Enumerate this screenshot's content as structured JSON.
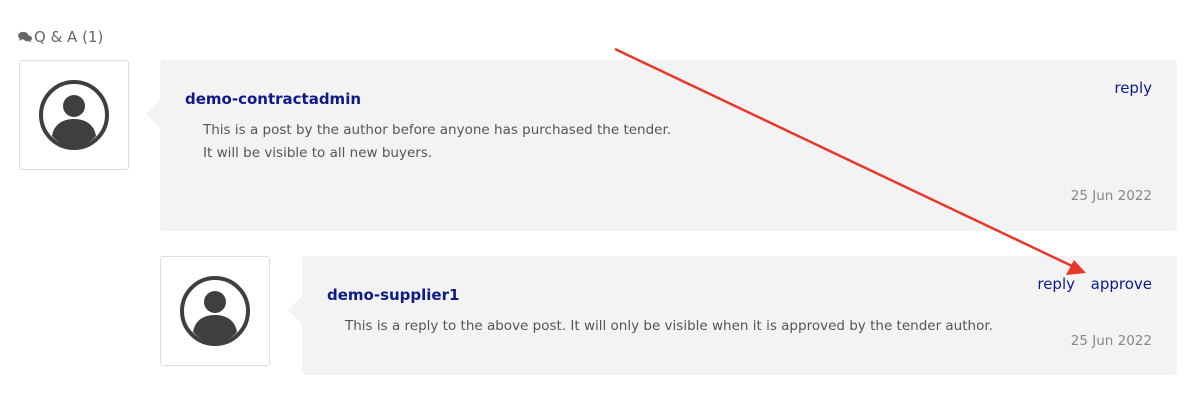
{
  "section": {
    "title": "Q & A (1)",
    "icon": "comments-icon"
  },
  "posts": [
    {
      "author": "demo-contractadmin",
      "lines": [
        "This is a post by the author before anyone has purchased the tender.",
        "It will be visible to all new buyers."
      ],
      "reply_label": "reply",
      "date": "25 Jun 2022"
    },
    {
      "author": "demo-supplier1",
      "lines": [
        "This is a reply to the above post. It will only be visible when it is approved by the tender author."
      ],
      "reply_label": "reply",
      "approve_label": "approve",
      "date": "25 Jun 2022"
    }
  ],
  "colors": {
    "link": "#0c1a8a",
    "annotation_arrow": "#e8372a",
    "bubble": "#f3f3f3"
  }
}
